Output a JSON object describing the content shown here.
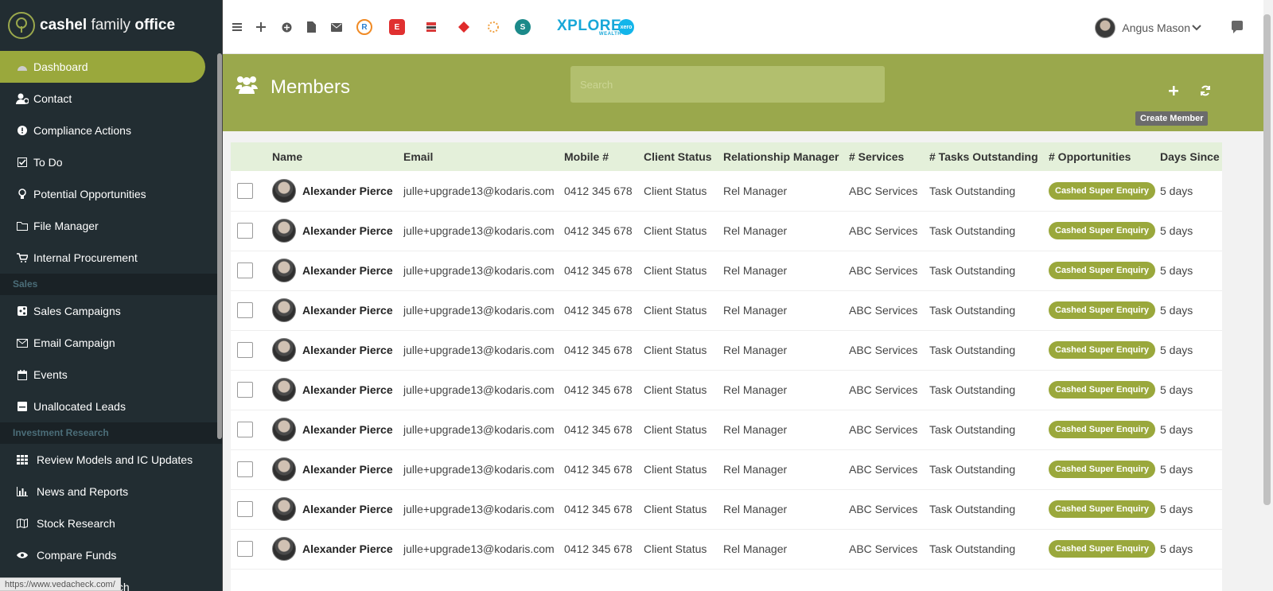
{
  "brand": {
    "name_bold": "cashel",
    "name_mid": "family",
    "name_end": "office"
  },
  "sidebar": {
    "items": [
      {
        "label": "Dashboard",
        "icon": "dashboard-icon"
      },
      {
        "label": "Contact",
        "icon": "contact-icon"
      },
      {
        "label": "Compliance Actions",
        "icon": "exclamation-icon"
      },
      {
        "label": "To Do",
        "icon": "checkbox-icon"
      },
      {
        "label": "Potential Opportunities",
        "icon": "lightbulb-icon"
      },
      {
        "label": "File Manager",
        "icon": "folder-icon"
      },
      {
        "label": "Internal Procurement",
        "icon": "cart-icon"
      }
    ],
    "section_sales": "Sales",
    "sales_items": [
      {
        "label": "Sales Campaigns",
        "icon": "share-icon"
      },
      {
        "label": "Email Campaign",
        "icon": "envelope-icon"
      },
      {
        "label": "Events",
        "icon": "calendar-icon"
      },
      {
        "label": "Unallocated Leads",
        "icon": "inbox-icon"
      }
    ],
    "section_research": "Investment Research",
    "research_items": [
      {
        "label": "Review Models and IC Updates",
        "icon": "grid-icon"
      },
      {
        "label": "News and Reports",
        "icon": "bar-chart-icon"
      },
      {
        "label": "Stock Research",
        "icon": "map-icon"
      },
      {
        "label": "Compare Funds",
        "icon": "eye-icon"
      },
      {
        "label": "Property Research",
        "icon": "building-icon"
      }
    ],
    "status_url": "https://www.vedacheck.com/"
  },
  "topbar": {
    "user_name": "Angus Mason",
    "xplore_label": "XPLORE",
    "xplore_sub": "WEALTH"
  },
  "header": {
    "title": "Members",
    "search_placeholder": "Search",
    "tooltip": "Create Member"
  },
  "table": {
    "columns": [
      "Name",
      "Email",
      "Mobile #",
      "Client Status",
      "Relationship Manager",
      "# Services",
      "# Tasks Outstanding",
      "# Opportunities",
      "Days Since L"
    ],
    "rows": [
      {
        "name": "Alexander Pierce",
        "email": "julle+upgrade13@kodaris.com",
        "mobile": "0412 345 678",
        "status": "Client Status",
        "manager": "Rel Manager",
        "services": "ABC Services",
        "tasks": "Task Outstanding",
        "opportunity": "Cashed Super Enquiry",
        "days": "5 days"
      },
      {
        "name": "Alexander Pierce",
        "email": "julle+upgrade13@kodaris.com",
        "mobile": "0412 345 678",
        "status": "Client Status",
        "manager": "Rel Manager",
        "services": "ABC Services",
        "tasks": "Task Outstanding",
        "opportunity": "Cashed Super Enquiry",
        "days": "5 days"
      },
      {
        "name": "Alexander Pierce",
        "email": "julle+upgrade13@kodaris.com",
        "mobile": "0412 345 678",
        "status": "Client Status",
        "manager": "Rel Manager",
        "services": "ABC Services",
        "tasks": "Task Outstanding",
        "opportunity": "Cashed Super Enquiry",
        "days": "5 days"
      },
      {
        "name": "Alexander Pierce",
        "email": "julle+upgrade13@kodaris.com",
        "mobile": "0412 345 678",
        "status": "Client Status",
        "manager": "Rel Manager",
        "services": "ABC Services",
        "tasks": "Task Outstanding",
        "opportunity": "Cashed Super Enquiry",
        "days": "5 days"
      },
      {
        "name": "Alexander Pierce",
        "email": "julle+upgrade13@kodaris.com",
        "mobile": "0412 345 678",
        "status": "Client Status",
        "manager": "Rel Manager",
        "services": "ABC Services",
        "tasks": "Task Outstanding",
        "opportunity": "Cashed Super Enquiry",
        "days": "5 days"
      },
      {
        "name": "Alexander Pierce",
        "email": "julle+upgrade13@kodaris.com",
        "mobile": "0412 345 678",
        "status": "Client Status",
        "manager": "Rel Manager",
        "services": "ABC Services",
        "tasks": "Task Outstanding",
        "opportunity": "Cashed Super Enquiry",
        "days": "5 days"
      },
      {
        "name": "Alexander Pierce",
        "email": "julle+upgrade13@kodaris.com",
        "mobile": "0412 345 678",
        "status": "Client Status",
        "manager": "Rel Manager",
        "services": "ABC Services",
        "tasks": "Task Outstanding",
        "opportunity": "Cashed Super Enquiry",
        "days": "5 days"
      },
      {
        "name": "Alexander Pierce",
        "email": "julle+upgrade13@kodaris.com",
        "mobile": "0412 345 678",
        "status": "Client Status",
        "manager": "Rel Manager",
        "services": "ABC Services",
        "tasks": "Task Outstanding",
        "opportunity": "Cashed Super Enquiry",
        "days": "5 days"
      },
      {
        "name": "Alexander Pierce",
        "email": "julle+upgrade13@kodaris.com",
        "mobile": "0412 345 678",
        "status": "Client Status",
        "manager": "Rel Manager",
        "services": "ABC Services",
        "tasks": "Task Outstanding",
        "opportunity": "Cashed Super Enquiry",
        "days": "5 days"
      },
      {
        "name": "Alexander Pierce",
        "email": "julle+upgrade13@kodaris.com",
        "mobile": "0412 345 678",
        "status": "Client Status",
        "manager": "Rel Manager",
        "services": "ABC Services",
        "tasks": "Task Outstanding",
        "opportunity": "Cashed Super Enquiry",
        "days": "5 days"
      }
    ]
  },
  "colors": {
    "accent": "#9aa83c",
    "sidebar": "#222d32",
    "band": "#9aa84c"
  }
}
